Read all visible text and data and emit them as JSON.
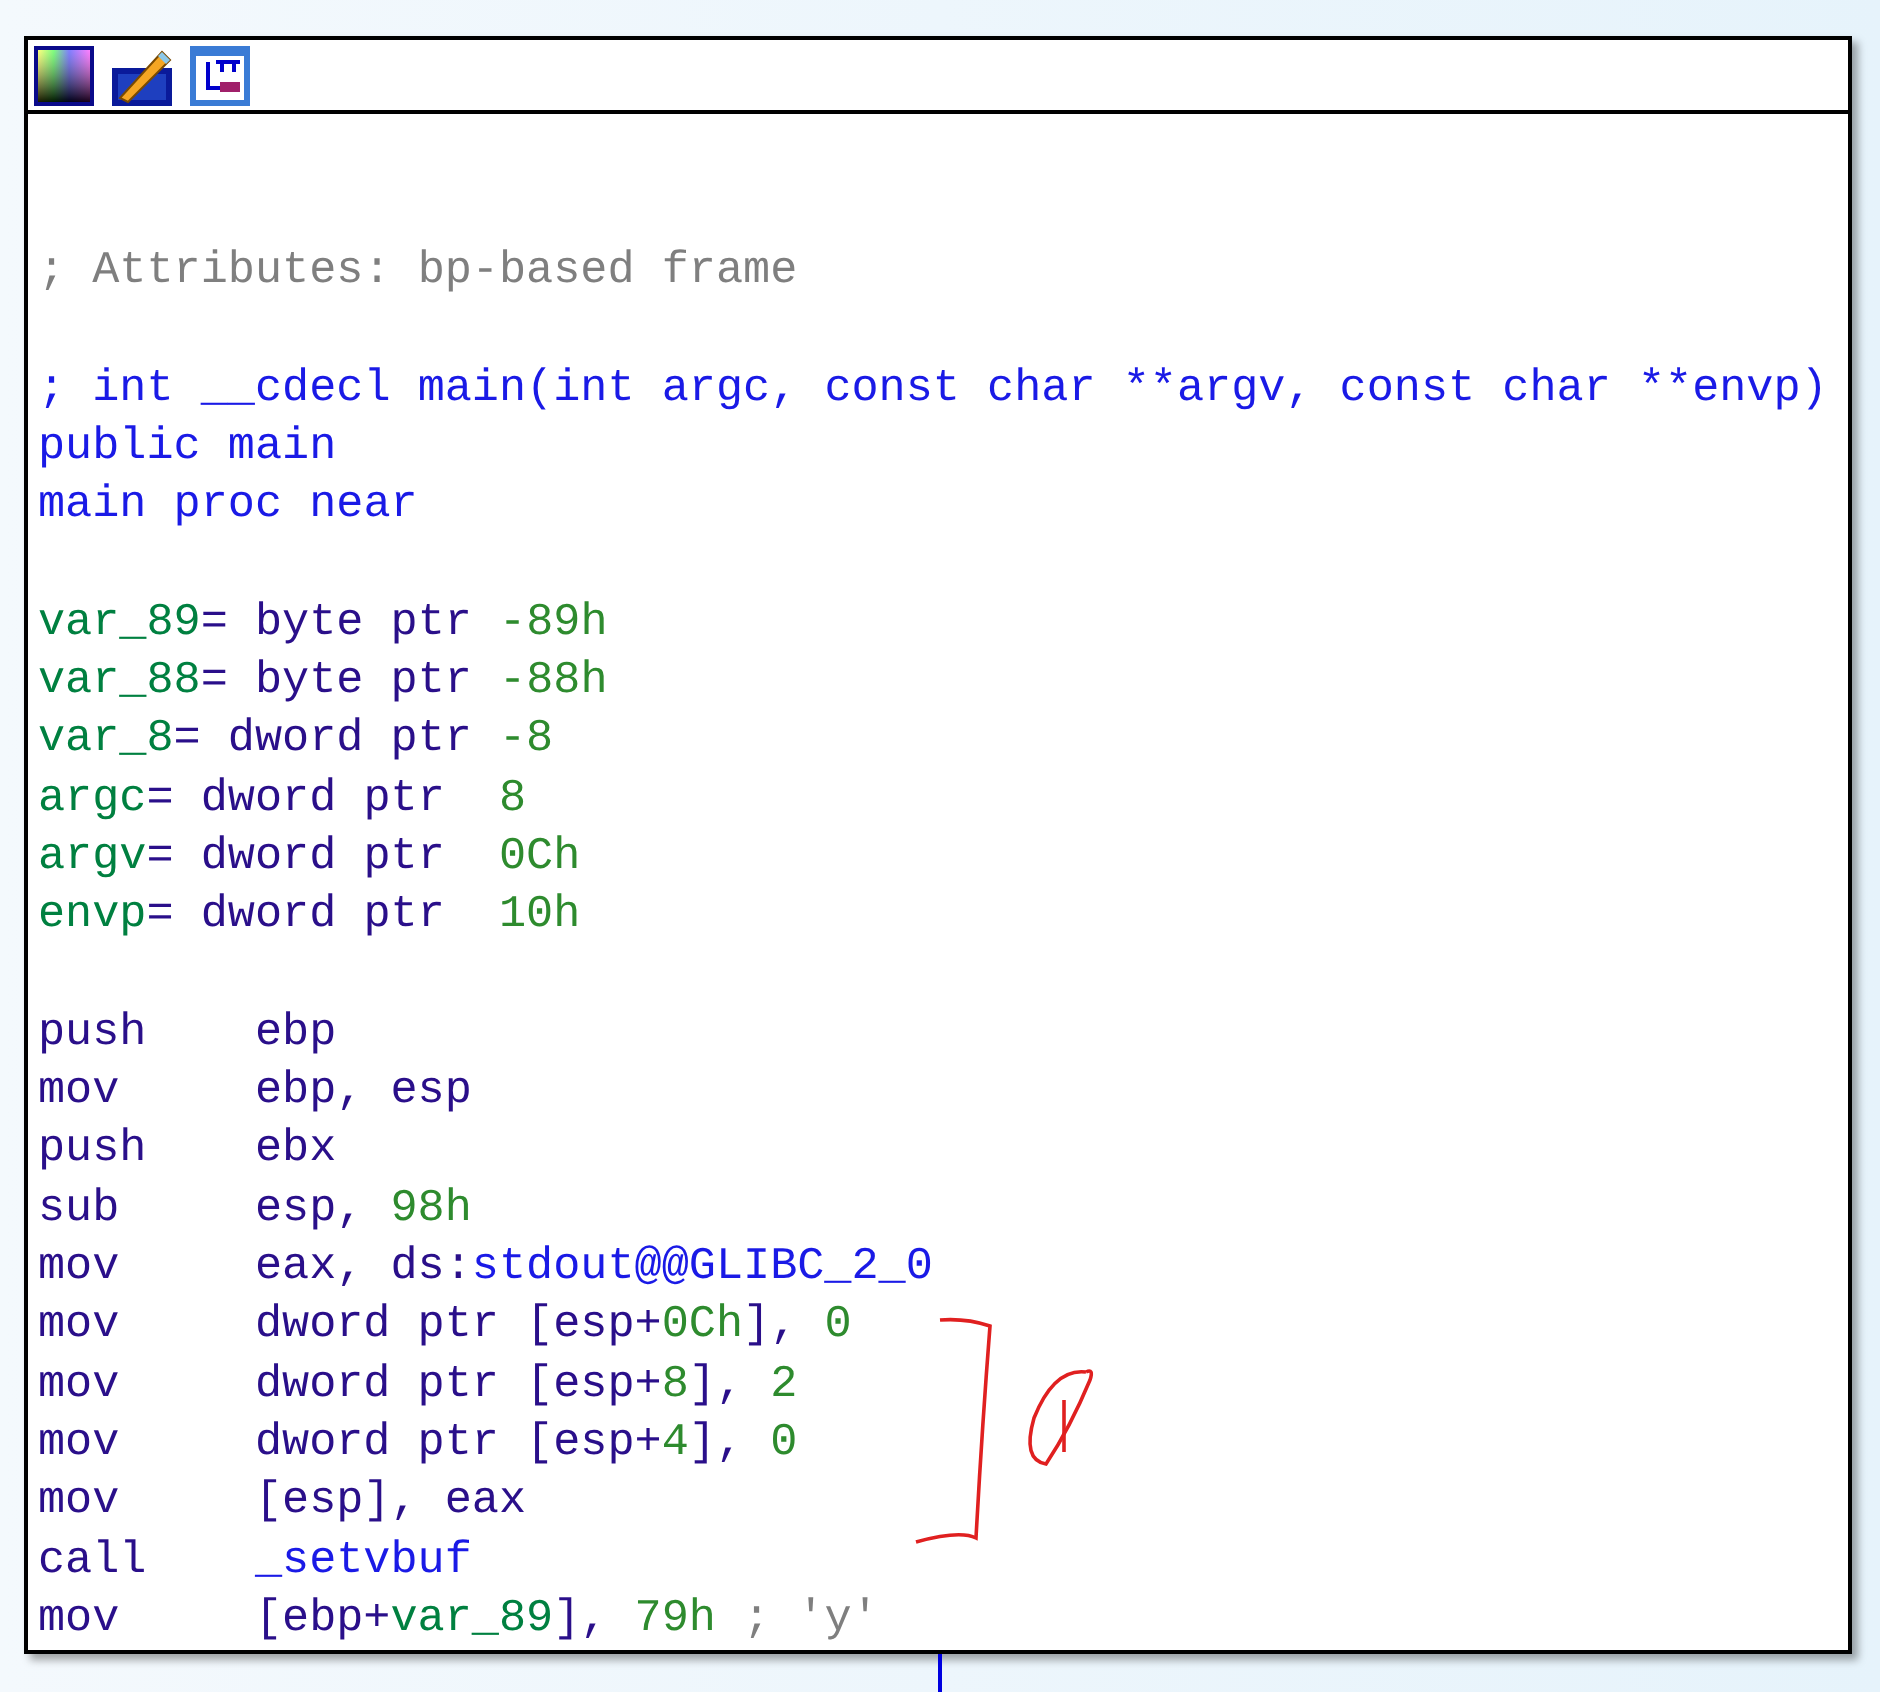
{
  "toolbar": {
    "buttons": [
      {
        "kind": "palette"
      },
      {
        "kind": "pencil"
      },
      {
        "kind": "graph"
      }
    ]
  },
  "listing": [
    {
      "kind": "comment",
      "segments": [
        {
          "kind": "comment",
          "text": "; Attributes: bp-based frame"
        }
      ]
    },
    {
      "kind": "blank"
    },
    {
      "kind": "text",
      "segments": [
        {
          "kind": "name",
          "text": "; int __cdecl main(int argc, const char **argv, const char **envp)"
        }
      ]
    },
    {
      "kind": "text",
      "segments": [
        {
          "kind": "name",
          "text": "public main"
        }
      ]
    },
    {
      "kind": "text",
      "segments": [
        {
          "kind": "name",
          "text": "main proc near"
        }
      ]
    },
    {
      "kind": "blank"
    },
    {
      "kind": "text",
      "segments": [
        {
          "kind": "var",
          "text": "var_89"
        },
        {
          "kind": "plain",
          "text": "= byte ptr "
        },
        {
          "kind": "number",
          "text": "-89h"
        }
      ]
    },
    {
      "kind": "text",
      "segments": [
        {
          "kind": "var",
          "text": "var_88"
        },
        {
          "kind": "plain",
          "text": "= byte ptr "
        },
        {
          "kind": "number",
          "text": "-88h"
        }
      ]
    },
    {
      "kind": "text",
      "segments": [
        {
          "kind": "var",
          "text": "var_8"
        },
        {
          "kind": "plain",
          "text": "= dword ptr "
        },
        {
          "kind": "number",
          "text": "-8"
        }
      ]
    },
    {
      "kind": "text",
      "segments": [
        {
          "kind": "var",
          "text": "argc"
        },
        {
          "kind": "plain",
          "text": "= dword ptr  "
        },
        {
          "kind": "number",
          "text": "8"
        }
      ]
    },
    {
      "kind": "text",
      "segments": [
        {
          "kind": "var",
          "text": "argv"
        },
        {
          "kind": "plain",
          "text": "= dword ptr  "
        },
        {
          "kind": "number",
          "text": "0Ch"
        }
      ]
    },
    {
      "kind": "text",
      "segments": [
        {
          "kind": "var",
          "text": "envp"
        },
        {
          "kind": "plain",
          "text": "= dword ptr  "
        },
        {
          "kind": "number",
          "text": "10h"
        }
      ]
    },
    {
      "kind": "blank"
    },
    {
      "kind": "insn",
      "mnemonic": "push",
      "segments": [
        {
          "kind": "plain",
          "text": "ebp"
        }
      ]
    },
    {
      "kind": "insn",
      "mnemonic": "mov",
      "segments": [
        {
          "kind": "plain",
          "text": "ebp, esp"
        }
      ]
    },
    {
      "kind": "insn",
      "mnemonic": "push",
      "segments": [
        {
          "kind": "plain",
          "text": "ebx"
        }
      ]
    },
    {
      "kind": "insn",
      "mnemonic": "sub",
      "segments": [
        {
          "kind": "plain",
          "text": "esp, "
        },
        {
          "kind": "number",
          "text": "98h"
        }
      ]
    },
    {
      "kind": "insn",
      "mnemonic": "mov",
      "segments": [
        {
          "kind": "plain",
          "text": "eax, ds:"
        },
        {
          "kind": "name",
          "text": "stdout@@GLIBC_2_0"
        }
      ]
    },
    {
      "kind": "insn",
      "mnemonic": "mov",
      "segments": [
        {
          "kind": "plain",
          "text": "dword ptr [esp+"
        },
        {
          "kind": "number",
          "text": "0Ch"
        },
        {
          "kind": "plain",
          "text": "], "
        },
        {
          "kind": "number",
          "text": "0"
        }
      ]
    },
    {
      "kind": "insn",
      "mnemonic": "mov",
      "segments": [
        {
          "kind": "plain",
          "text": "dword ptr [esp+"
        },
        {
          "kind": "number",
          "text": "8"
        },
        {
          "kind": "plain",
          "text": "], "
        },
        {
          "kind": "number",
          "text": "2"
        }
      ]
    },
    {
      "kind": "insn",
      "mnemonic": "mov",
      "segments": [
        {
          "kind": "plain",
          "text": "dword ptr [esp+"
        },
        {
          "kind": "number",
          "text": "4"
        },
        {
          "kind": "plain",
          "text": "], "
        },
        {
          "kind": "number",
          "text": "0"
        }
      ]
    },
    {
      "kind": "insn",
      "mnemonic": "mov",
      "segments": [
        {
          "kind": "plain",
          "text": "[esp], eax"
        }
      ]
    },
    {
      "kind": "insn",
      "mnemonic": "call",
      "segments": [
        {
          "kind": "name",
          "text": "_setvbuf"
        }
      ]
    },
    {
      "kind": "insn",
      "mnemonic": "mov",
      "segments": [
        {
          "kind": "plain",
          "text": "[ebp+"
        },
        {
          "kind": "var",
          "text": "var_89"
        },
        {
          "kind": "plain",
          "text": "], "
        },
        {
          "kind": "number",
          "text": "79h"
        },
        {
          "kind": "comment",
          "text": " ; 'y'"
        }
      ]
    }
  ],
  "annotation": {
    "kind": "bracket-circle"
  }
}
